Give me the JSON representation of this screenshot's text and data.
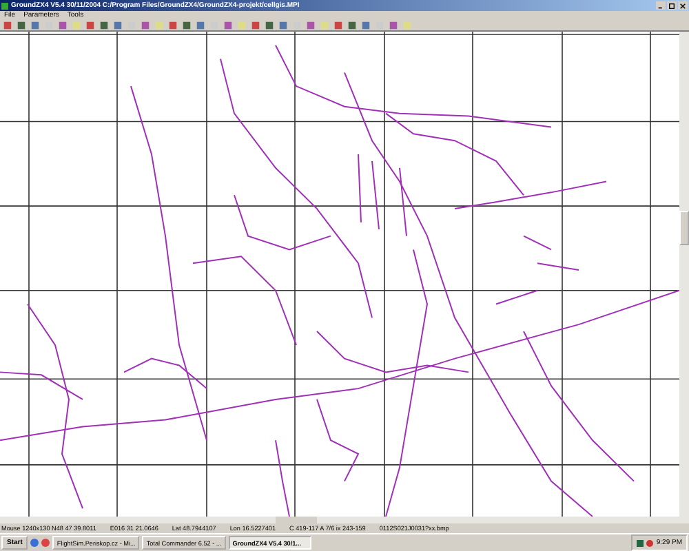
{
  "window": {
    "title": "GroundZX4 V5.4 30/11/2004 C:/Program Files/GroundZX4/GroundZX4-projekt/cellgis.MPI"
  },
  "menu": [
    "File",
    "Parameters",
    "Tools"
  ],
  "status_bar": [
    "Mouse 1240x130 N48 47 39.8011",
    "E016 31 21.0646",
    "Lat 48.7944107",
    "Lon 16.5227401",
    "C 419-117 A 7/6 ix 243-159",
    "0112S021J0031?xx.bmp"
  ],
  "taskbar": {
    "start": "Start",
    "tasks": [
      {
        "label": "FlightSim.Periskop.cz - Mi...",
        "selected": false
      },
      {
        "label": "Total Commander 6.52 - ...",
        "selected": false
      },
      {
        "label": "GroundZX4 V5.4 30/1...",
        "selected": true
      }
    ],
    "clock": "9:29 PM"
  }
}
